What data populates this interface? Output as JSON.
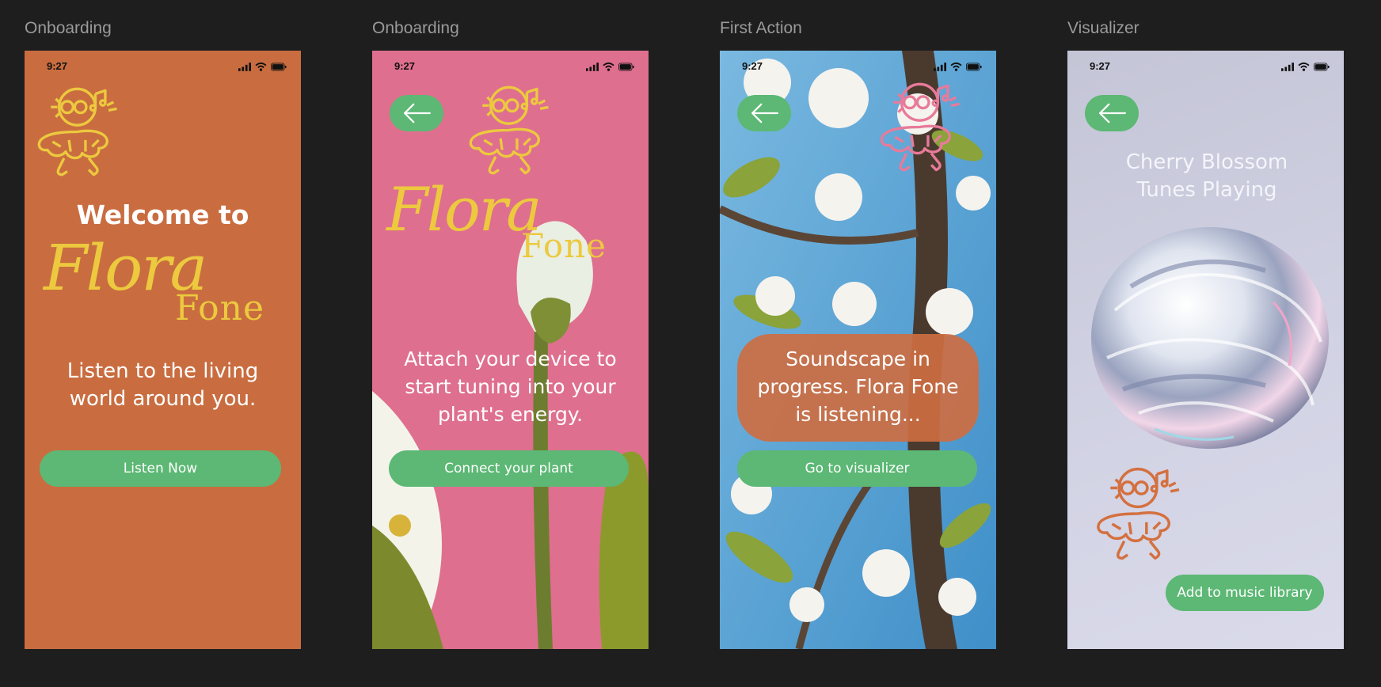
{
  "frames": [
    {
      "label": "Onboarding",
      "time": "9:27",
      "title": "Welcome to",
      "logo_top": "Flora",
      "logo_bottom": "Fone",
      "tagline": "Listen to the living world around you.",
      "cta": "Listen Now"
    },
    {
      "label": "Onboarding",
      "time": "9:27",
      "logo_top": "Flora",
      "logo_bottom": "Fone",
      "body": "Attach your device to start tuning into your plant's energy.",
      "cta": "Connect your plant"
    },
    {
      "label": "First Action",
      "time": "9:27",
      "status_message": "Soundscape in progress. Flora Fone is listening...",
      "cta": "Go to visualizer"
    },
    {
      "label": "Visualizer",
      "time": "9:27",
      "title": "Cherry Blossom Tunes Playing",
      "cta": "Add to music library"
    }
  ],
  "colors": {
    "canvas": "#1e1e1e",
    "orange": "#c96d40",
    "pink": "#df6f8e",
    "green": "#5cb874",
    "logo_yellow": "#ecc93e",
    "lavender": "#c9c9dc"
  },
  "icons": [
    "flower-mascot-icon",
    "signal-icon",
    "wifi-icon",
    "battery-icon",
    "arrow-left-icon"
  ]
}
